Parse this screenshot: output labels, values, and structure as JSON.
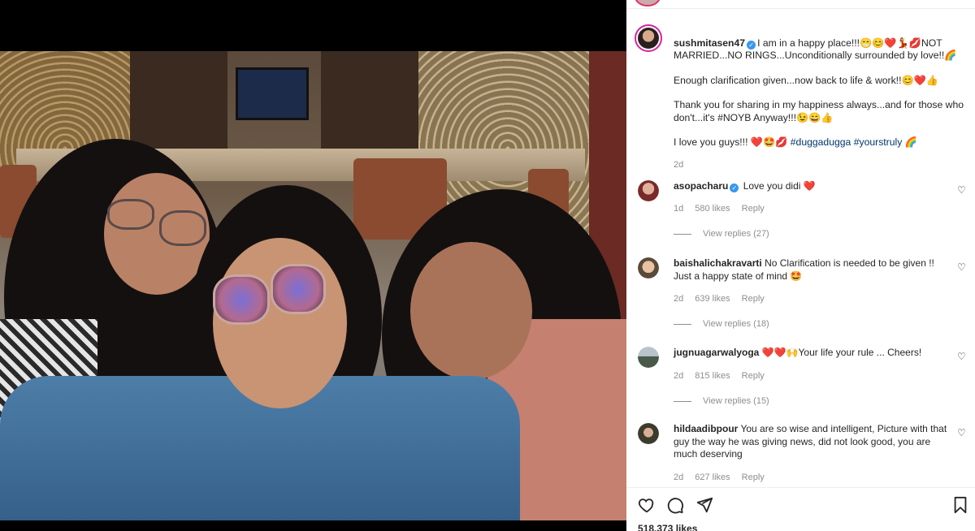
{
  "post": {
    "username": "sushmitasen47",
    "caption": [
      "I am in a happy place!!!😁😊❤️💃💋NOT MARRIED...NO RINGS...Unconditionally surrounded by love!!🌈",
      "Enough clarification given...now back to life & work!!😊❤️👍",
      "Thank you for sharing in my happiness always...and for those who don't...it's #NOYB Anyway!!!😉😄👍"
    ],
    "caption_last_prefix": "I love you guys!!! ❤️🤩💋 ",
    "caption_hashtags": "#duggadugga #yourstruly",
    "caption_last_suffix": " 🌈",
    "time": "2d"
  },
  "comments": [
    {
      "username": "asopacharu",
      "verified": true,
      "text": "Love you didi ❤️",
      "time": "1d",
      "likes": "580 likes",
      "reply": "Reply",
      "view_replies": "View replies (27)"
    },
    {
      "username": "baishalichakravarti",
      "verified": false,
      "text": "No Clarification is needed to be given !! Just a happy state of mind 🤩",
      "time": "2d",
      "likes": "639 likes",
      "reply": "Reply",
      "view_replies": "View replies (18)"
    },
    {
      "username": "jugnuagarwalyoga",
      "verified": false,
      "text": "❤️❤️🙌Your life your rule ... Cheers!",
      "time": "2d",
      "likes": "815 likes",
      "reply": "Reply",
      "view_replies": "View replies (15)"
    },
    {
      "username": "hildaadibpour",
      "verified": false,
      "text": "You are so wise and intelligent, Picture with that guy the way he was giving news, did not look good, you are much deserving",
      "time": "2d",
      "likes": "627 likes",
      "reply": "Reply"
    }
  ],
  "footer": {
    "likes": "518,373 likes"
  },
  "icons": {
    "like": "heart-icon",
    "comment": "comment-icon",
    "share": "paper-plane-icon",
    "save": "bookmark-icon",
    "comment_like": "heart-outline-icon"
  },
  "colors": {
    "verified": "#3897f0",
    "hashtag": "#00376b",
    "meta": "#8e8e8e",
    "story_ring": "#d6249f"
  }
}
